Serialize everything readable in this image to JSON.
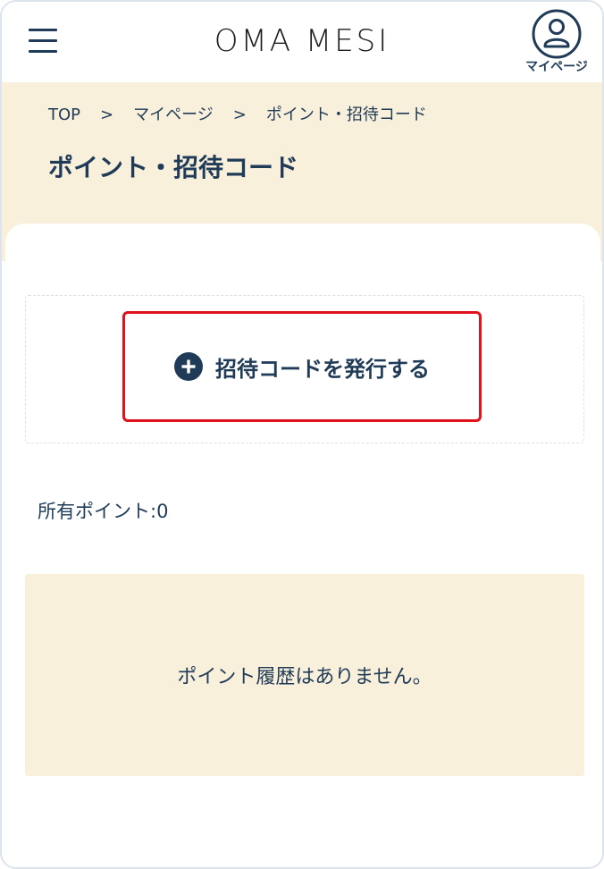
{
  "header": {
    "logo": "OMA MESI",
    "mypage_label": "マイページ"
  },
  "breadcrumb": {
    "items": [
      "TOP",
      "マイページ",
      "ポイント・招待コード"
    ],
    "separator": ">"
  },
  "page": {
    "title": "ポイント・招待コード"
  },
  "invite": {
    "issue_button_label": "招待コードを発行する"
  },
  "points": {
    "owned_text": "所有ポイント:0"
  },
  "history": {
    "empty_message": "ポイント履歴はありません。"
  },
  "colors": {
    "primary": "#1f3b57",
    "beige": "#f9f0dc",
    "highlight": "#e0121b"
  },
  "icons": {
    "menu": "hamburger-menu-icon",
    "mypage": "user-circle-icon",
    "issue": "plus-circle-icon"
  }
}
